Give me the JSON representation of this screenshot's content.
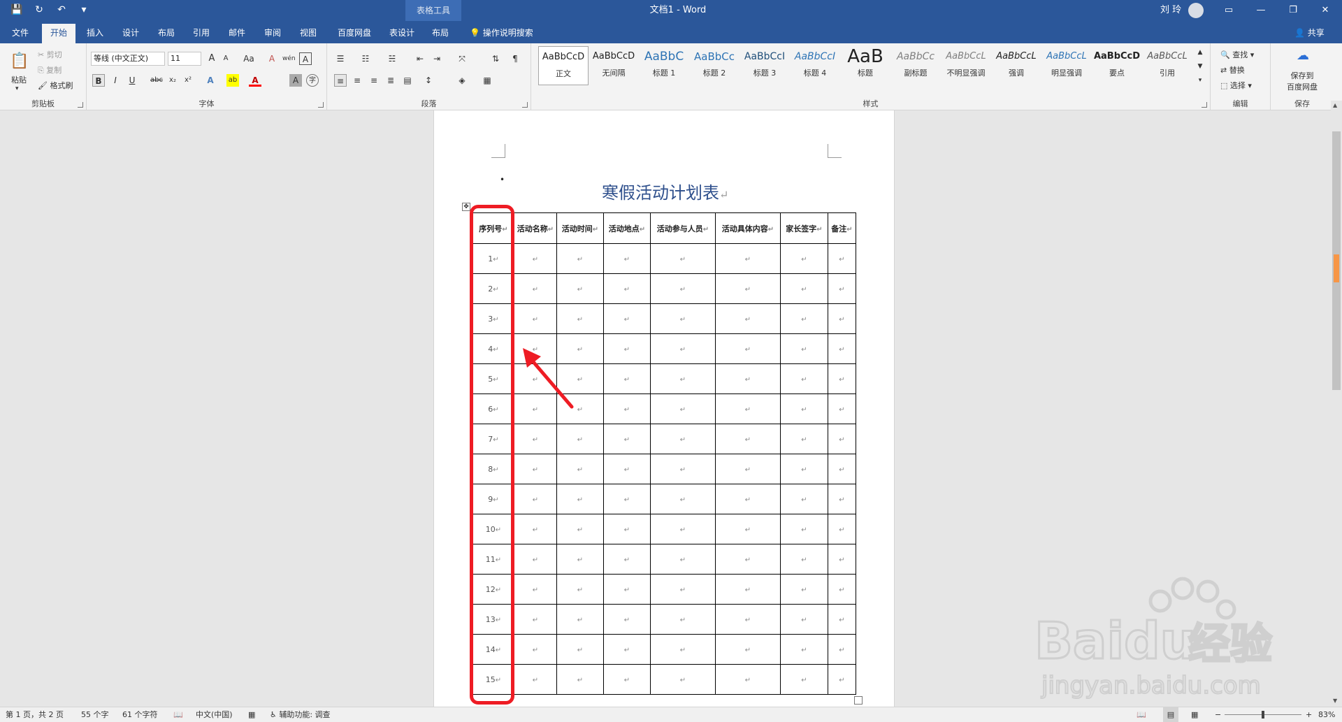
{
  "window": {
    "context_tab_group": "表格工具",
    "title": "文档1 - Word",
    "user_name": "刘 玲",
    "controls": {
      "ribbon_display": "▭",
      "minimize": "—",
      "restore": "❐",
      "close": "✕"
    }
  },
  "quick_access": {
    "save": "💾",
    "redo": "↻",
    "undo": "↶",
    "customize": "▾"
  },
  "tabs": [
    "文件",
    "开始",
    "插入",
    "设计",
    "布局",
    "引用",
    "邮件",
    "审阅",
    "视图",
    "百度网盘",
    "表设计",
    "布局"
  ],
  "active_tab_index": 1,
  "tell_me": "操作说明搜索",
  "share": "共享",
  "ribbon": {
    "clipboard": {
      "label": "剪贴板",
      "paste": "粘贴",
      "cut": "剪切",
      "copy": "复制",
      "format_painter": "格式刷"
    },
    "font": {
      "label": "字体",
      "font_name": "等线 (中文正文)",
      "font_size": "11",
      "grow": "A",
      "shrink": "A",
      "change_case": "Aa",
      "clear": "A",
      "phonetic": "wén",
      "border_char": "A",
      "bold": "B",
      "italic": "I",
      "underline": "U",
      "strike": "abc",
      "subscript": "x₂",
      "superscript": "x²",
      "text_effects": "A",
      "highlight": "ab",
      "font_color": "A",
      "char_shading": "A",
      "enclose": "字"
    },
    "paragraph": {
      "label": "段落"
    },
    "styles": {
      "label": "样式",
      "items": [
        {
          "preview": "AaBbCcD",
          "name": "正文"
        },
        {
          "preview": "AaBbCcD",
          "name": "无间隔"
        },
        {
          "preview": "AaBbC",
          "name": "标题 1"
        },
        {
          "preview": "AaBbCc",
          "name": "标题 2"
        },
        {
          "preview": "AaBbCcI",
          "name": "标题 3"
        },
        {
          "preview": "AaBbCcI",
          "name": "标题 4"
        },
        {
          "preview": "AaB",
          "name": "标题"
        },
        {
          "preview": "AaBbCc",
          "name": "副标题"
        },
        {
          "preview": "AaBbCcL",
          "name": "不明显强调"
        },
        {
          "preview": "AaBbCcL",
          "name": "强调"
        },
        {
          "preview": "AaBbCcL",
          "name": "明显强调"
        },
        {
          "preview": "AaBbCcD",
          "name": "要点"
        },
        {
          "preview": "AaBbCcL",
          "name": "引用"
        }
      ]
    },
    "editing": {
      "label": "编辑",
      "find": "查找",
      "replace": "替换",
      "select": "选择"
    },
    "save_group": {
      "label": "保存",
      "save_to_baidu_line1": "保存到",
      "save_to_baidu_line2": "百度网盘"
    }
  },
  "document": {
    "title": "寒假活动计划表",
    "paragraph_mark": "↵",
    "bullet": "•",
    "table": {
      "headers": [
        "序列号",
        "活动名称",
        "活动时间",
        "活动地点",
        "活动参与人员",
        "活动具体内容",
        "家长签字",
        "备注"
      ],
      "row_numbers": [
        "1",
        "2",
        "3",
        "4",
        "5",
        "6",
        "7",
        "8",
        "9",
        "10",
        "11",
        "12",
        "13",
        "14",
        "15"
      ]
    }
  },
  "status_bar": {
    "page": "第 1 页，共 2 页",
    "words": "55 个字",
    "chars": "61 个字符",
    "language": "中文(中国)",
    "accessibility": "辅助功能: 调查",
    "zoom_minus": "−",
    "zoom_plus": "+",
    "zoom_level": "83%"
  },
  "watermark": {
    "brand": "Baidu",
    "cn": "经验",
    "url": "jingyan.baidu.com"
  },
  "colors": {
    "accent": "#2b579a",
    "highlight": "#ee1c24",
    "heading": "#2e4f8c"
  }
}
